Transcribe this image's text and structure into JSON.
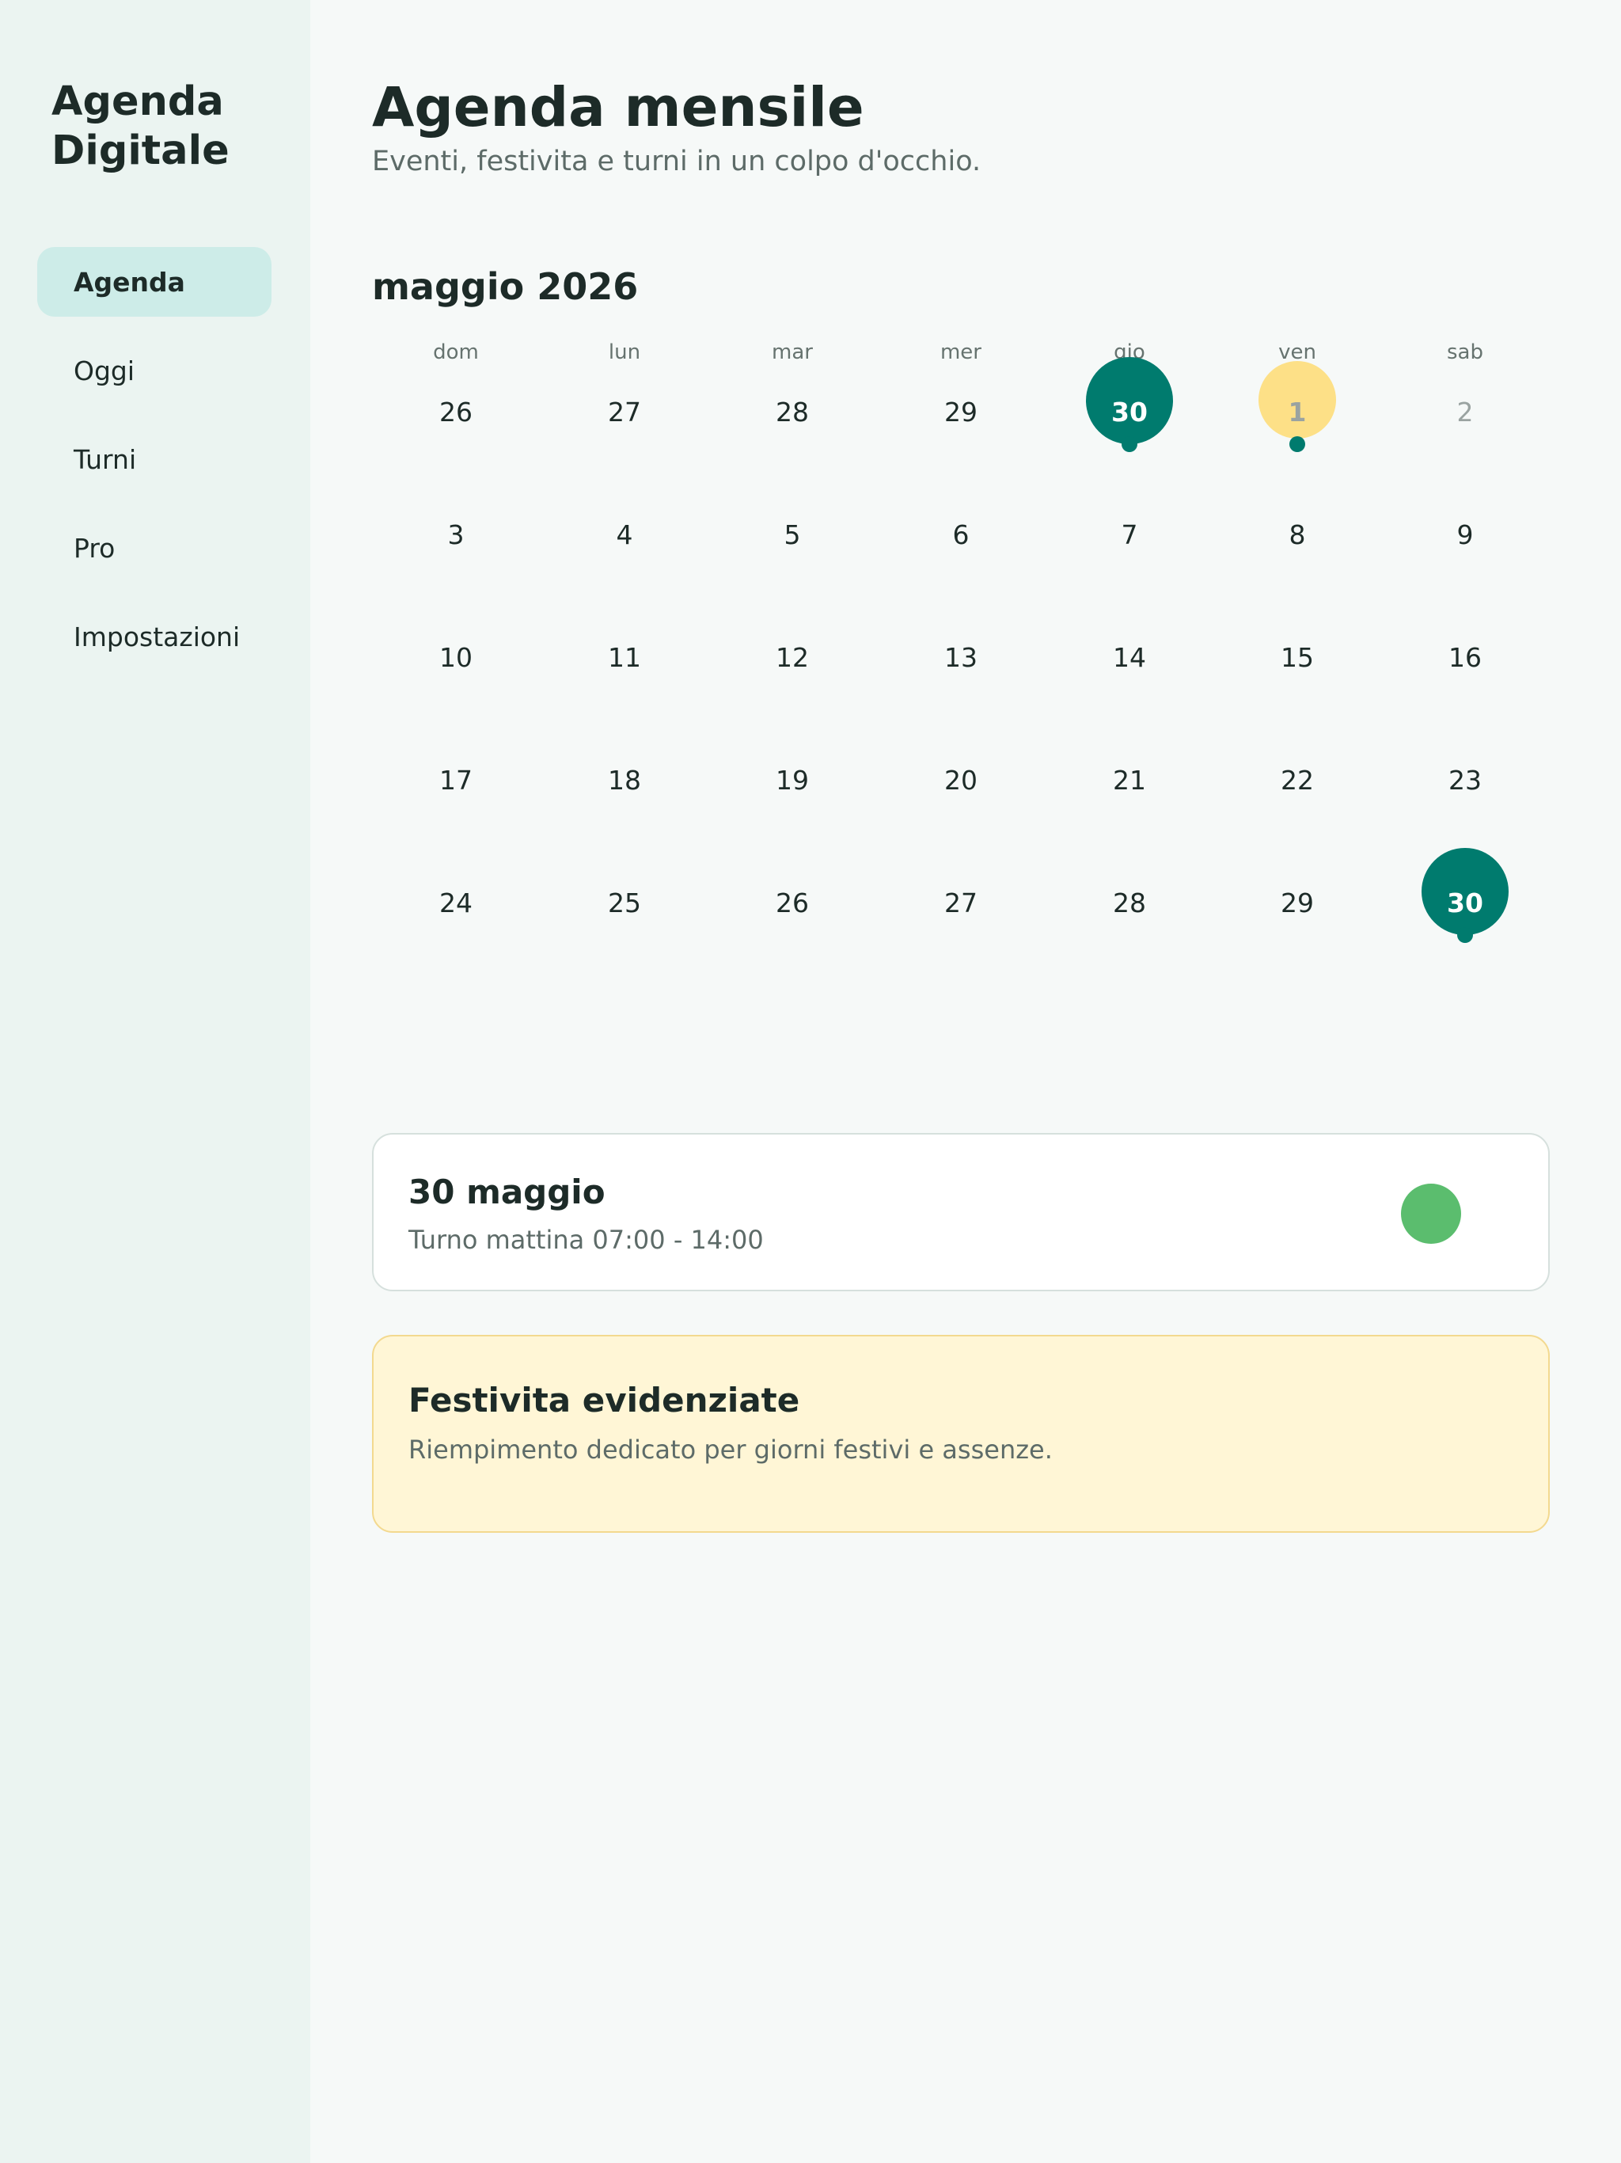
{
  "sidebar": {
    "brand": "Agenda Digitale",
    "items": [
      {
        "label": "Agenda",
        "active": true
      },
      {
        "label": "Oggi",
        "active": false
      },
      {
        "label": "Turni",
        "active": false
      },
      {
        "label": "Pro",
        "active": false
      },
      {
        "label": "Impostazioni",
        "active": false
      }
    ]
  },
  "header": {
    "title": "Agenda mensile",
    "subtitle": "Eventi, festivita e turni in un colpo d'occhio."
  },
  "calendar": {
    "month_label": "maggio 2026",
    "weekdays": [
      "dom",
      "lun",
      "mar",
      "mer",
      "gio",
      "ven",
      "sab"
    ],
    "weeks": [
      [
        {
          "day": "26"
        },
        {
          "day": "27"
        },
        {
          "day": "28"
        },
        {
          "day": "29"
        },
        {
          "day": "30",
          "state": "selected",
          "dot": true
        },
        {
          "day": "1",
          "state": "holiday",
          "dot": true
        },
        {
          "day": "2",
          "state": "muted"
        }
      ],
      [
        {
          "day": "3"
        },
        {
          "day": "4"
        },
        {
          "day": "5"
        },
        {
          "day": "6"
        },
        {
          "day": "7"
        },
        {
          "day": "8"
        },
        {
          "day": "9"
        }
      ],
      [
        {
          "day": "10"
        },
        {
          "day": "11"
        },
        {
          "day": "12"
        },
        {
          "day": "13"
        },
        {
          "day": "14"
        },
        {
          "day": "15"
        },
        {
          "day": "16"
        }
      ],
      [
        {
          "day": "17"
        },
        {
          "day": "18"
        },
        {
          "day": "19"
        },
        {
          "day": "20"
        },
        {
          "day": "21"
        },
        {
          "day": "22"
        },
        {
          "day": "23"
        }
      ],
      [
        {
          "day": "24"
        },
        {
          "day": "25"
        },
        {
          "day": "26"
        },
        {
          "day": "27"
        },
        {
          "day": "28"
        },
        {
          "day": "29"
        },
        {
          "day": "30",
          "state": "selected",
          "dot": true
        }
      ]
    ]
  },
  "event": {
    "date": "30 maggio",
    "description": "Turno mattina 07:00 - 14:00",
    "color": "#5bbd6e"
  },
  "holiday_info": {
    "title": "Festivita evidenziate",
    "description": "Riempimento dedicato per giorni festivi e assenze."
  },
  "colors": {
    "accent": "#007b6e",
    "holiday": "#fde087",
    "nav_active": "#cdece8"
  }
}
